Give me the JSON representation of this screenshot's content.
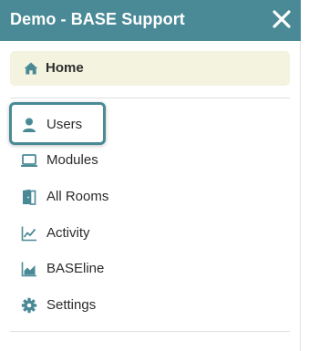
{
  "header": {
    "title": "Demo - BASE Support",
    "close_icon": "close-icon"
  },
  "home": {
    "label": "Home",
    "icon": "home-icon"
  },
  "nav": {
    "items": [
      {
        "label": "Users",
        "icon": "user-icon"
      },
      {
        "label": "Modules",
        "icon": "laptop-icon"
      },
      {
        "label": "All Rooms",
        "icon": "door-icon"
      },
      {
        "label": "Activity",
        "icon": "line-chart-icon"
      },
      {
        "label": "BASEline",
        "icon": "area-chart-icon"
      },
      {
        "label": "Settings",
        "icon": "gear-icon"
      }
    ]
  },
  "colors": {
    "accent": "#4a8a97",
    "home_bg": "#f3f3df",
    "icon": "#4a8a97"
  }
}
